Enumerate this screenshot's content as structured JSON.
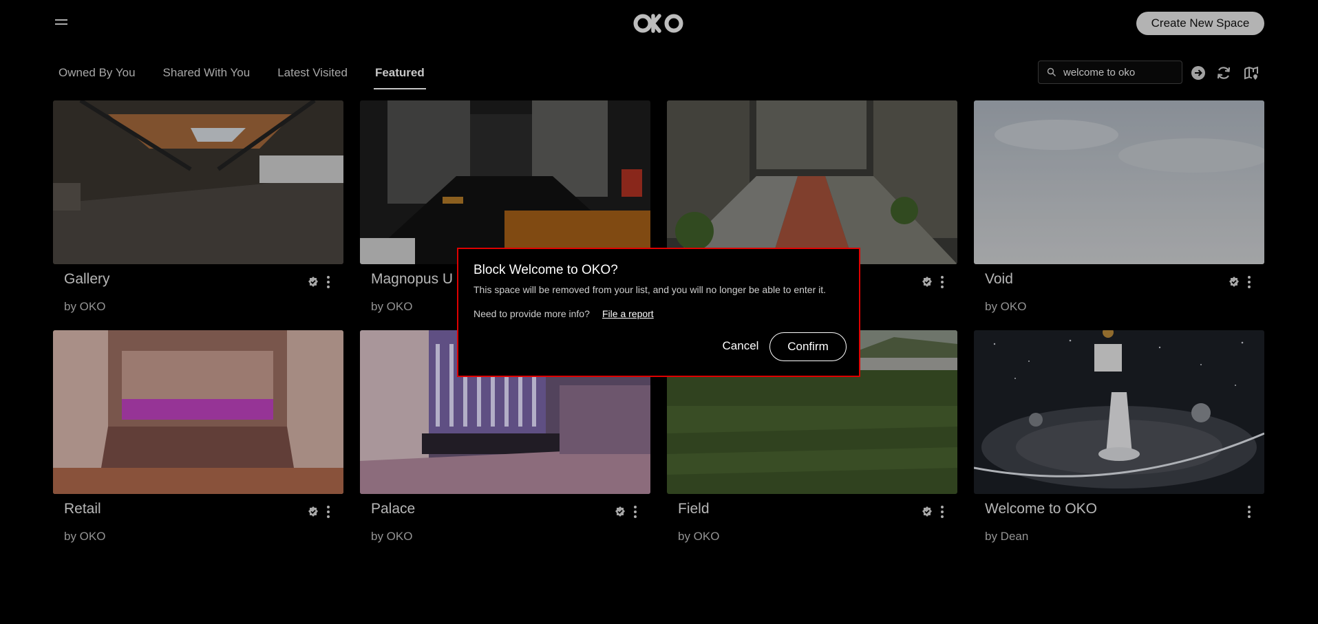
{
  "header": {
    "menu_icon": "hamburger-icon",
    "logo_text": "OKO",
    "create_button": "Create New Space"
  },
  "tabs": [
    {
      "label": "Owned By You",
      "active": false
    },
    {
      "label": "Shared With You",
      "active": false
    },
    {
      "label": "Latest Visited",
      "active": false
    },
    {
      "label": "Featured",
      "active": true
    }
  ],
  "search": {
    "value": "welcome to oko",
    "icon": "search-icon"
  },
  "toolbar_icons": [
    "arrow-right-circle-icon",
    "refresh-icon",
    "map-pin-icon"
  ],
  "cards": [
    {
      "title": "Gallery",
      "owner": "by OKO",
      "verified": true,
      "scene": "gallery"
    },
    {
      "title": "Magnopus U",
      "owner": "by OKO",
      "verified": true,
      "scene": "office"
    },
    {
      "title": "",
      "owner": "",
      "verified": true,
      "scene": "atrium"
    },
    {
      "title": "Void",
      "owner": "by OKO",
      "verified": true,
      "scene": "void"
    },
    {
      "title": "Retail",
      "owner": "by OKO",
      "verified": true,
      "scene": "retail"
    },
    {
      "title": "Palace",
      "owner": "by OKO",
      "verified": true,
      "scene": "palace"
    },
    {
      "title": "Field",
      "owner": "by OKO",
      "verified": true,
      "scene": "field"
    },
    {
      "title": "Welcome to OKO",
      "owner": "by Dean",
      "verified": false,
      "scene": "space"
    }
  ],
  "dialog": {
    "title": "Block Welcome to OKO?",
    "message": "This space will be removed from your list, and you will no longer be able to enter it.",
    "more_info": "Need to provide more info?",
    "link": "File a report",
    "cancel": "Cancel",
    "confirm": "Confirm",
    "border_color": "#e00000"
  },
  "colors": {
    "background": "#000000",
    "create_button_bg": "#e6e6e6"
  }
}
